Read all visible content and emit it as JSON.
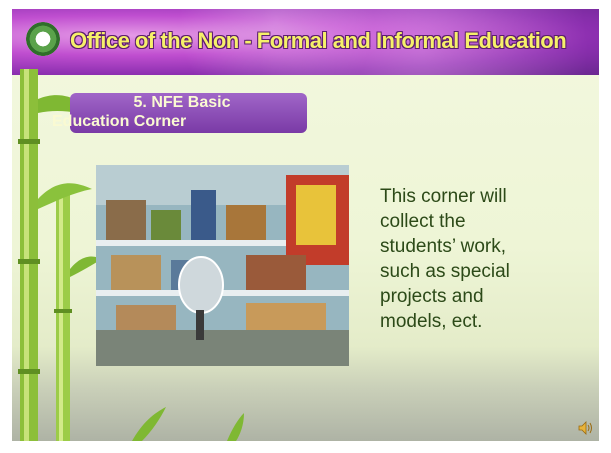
{
  "header": {
    "title": "Office of the Non - Formal and Informal Education"
  },
  "section": {
    "label_line1": "5.  NFE Basic",
    "label_line2": "Education Corner"
  },
  "body": {
    "text_lines": [
      "This corner will",
      "collect the",
      "students’ work,",
      "such as special",
      "projects and",
      "models, ect."
    ]
  },
  "icons": {
    "logo": "seal-logo-icon",
    "audio": "speaker-icon"
  },
  "colors": {
    "header_bg": "#9b3bbd",
    "title_text": "#f6f06a",
    "label_bg": "#8a4cb6",
    "label_text": "#fafad2",
    "body_text": "#2c4a18"
  }
}
